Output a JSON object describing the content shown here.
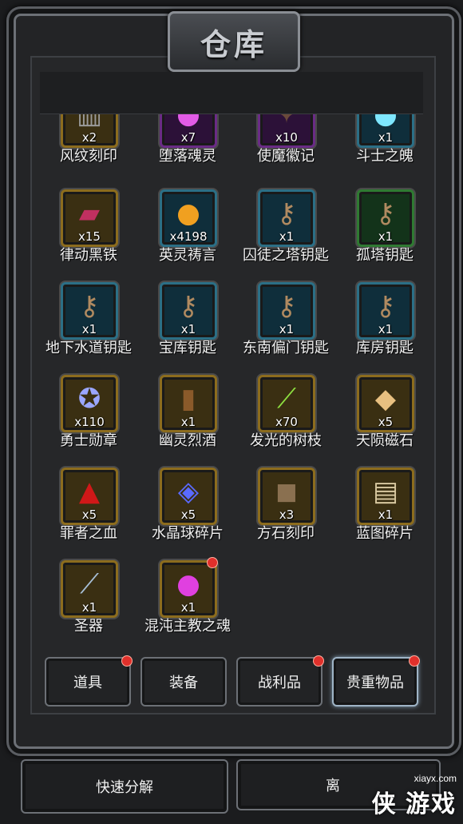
{
  "title": "仓库",
  "items": [
    {
      "name": "风纹刻印",
      "qty": "x2",
      "glyph": "▥",
      "frame": "gold",
      "color": "#9a9a9a"
    },
    {
      "name": "堕落魂灵",
      "qty": "x7",
      "glyph": "●",
      "frame": "purple",
      "color": "#e25be6"
    },
    {
      "name": "使魔徽记",
      "qty": "x10",
      "glyph": "✦",
      "frame": "purple",
      "color": "#6a4a3a"
    },
    {
      "name": "斗士之魄",
      "qty": "x1",
      "glyph": "●",
      "frame": "blue",
      "color": "#7ee7ff"
    },
    {
      "name": "律动黑铁",
      "qty": "x15",
      "glyph": "▰",
      "frame": "gold",
      "color": "#c03060"
    },
    {
      "name": "英灵祷言",
      "qty": "x4198",
      "glyph": "●",
      "frame": "blue",
      "color": "#f0a020"
    },
    {
      "name": "囚徒之塔钥匙",
      "qty": "x1",
      "glyph": "⚷",
      "frame": "blue",
      "color": "#b08a60"
    },
    {
      "name": "孤塔钥匙",
      "qty": "x1",
      "glyph": "⚷",
      "frame": "green",
      "color": "#b08a60"
    },
    {
      "name": "地下水道钥匙",
      "qty": "x1",
      "glyph": "⚷",
      "frame": "blue",
      "color": "#b08a60"
    },
    {
      "name": "宝库钥匙",
      "qty": "x1",
      "glyph": "⚷",
      "frame": "blue",
      "color": "#b08a60"
    },
    {
      "name": "东南偏门钥匙",
      "qty": "x1",
      "glyph": "⚷",
      "frame": "blue",
      "color": "#b08a60"
    },
    {
      "name": "库房钥匙",
      "qty": "x1",
      "glyph": "⚷",
      "frame": "blue",
      "color": "#b08a60"
    },
    {
      "name": "勇士勋章",
      "qty": "x110",
      "glyph": "✪",
      "frame": "gold",
      "color": "#9aa6ff"
    },
    {
      "name": "幽灵烈酒",
      "qty": "x1",
      "glyph": "▮",
      "frame": "gold",
      "color": "#8a5a2a"
    },
    {
      "name": "发光的树枝",
      "qty": "x70",
      "glyph": "⟋",
      "frame": "gold",
      "color": "#8ee040"
    },
    {
      "name": "天陨磁石",
      "qty": "x5",
      "glyph": "◆",
      "frame": "gold",
      "color": "#e8c080"
    },
    {
      "name": "罪者之血",
      "qty": "x5",
      "glyph": "▲",
      "frame": "gold",
      "color": "#d01818"
    },
    {
      "name": "水晶球碎片",
      "qty": "x5",
      "glyph": "◈",
      "frame": "gold",
      "color": "#5a6aff"
    },
    {
      "name": "方石刻印",
      "qty": "x3",
      "glyph": "◼",
      "frame": "gold",
      "color": "#8a7050"
    },
    {
      "name": "蓝图碎片",
      "qty": "x1",
      "glyph": "▤",
      "frame": "gold",
      "color": "#d8c8a0"
    },
    {
      "name": "圣器",
      "qty": "x1",
      "glyph": "⟋",
      "frame": "gold",
      "color": "#a8c0d8"
    },
    {
      "name": "混沌主教之魂",
      "qty": "x1",
      "glyph": "●",
      "frame": "gold",
      "color": "#e040e0",
      "new": true
    }
  ],
  "tabs": [
    {
      "label": "道具",
      "new": true
    },
    {
      "label": "装备",
      "new": false
    },
    {
      "label": "战利品",
      "new": true
    },
    {
      "label": "贵重物品",
      "new": true,
      "active": true
    }
  ],
  "buttons": {
    "quick_disassemble": "快速分解",
    "right_partial": "离"
  },
  "watermark": {
    "url": "xiayx.com",
    "text": "侠 游戏"
  }
}
